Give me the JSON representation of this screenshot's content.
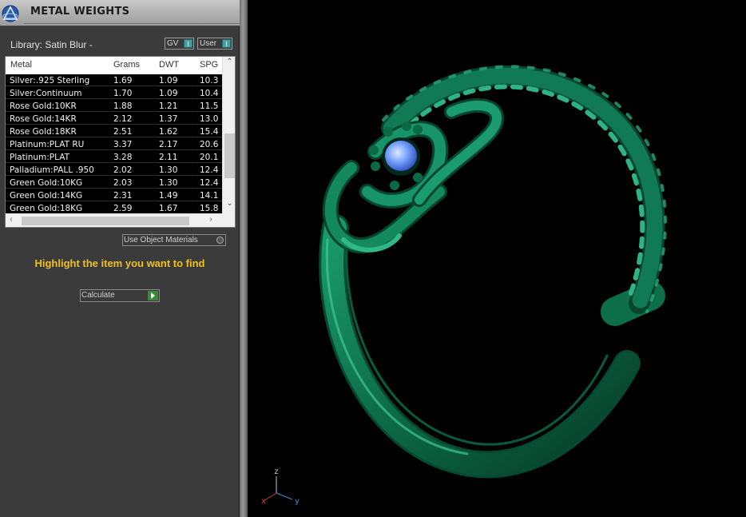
{
  "panel": {
    "title": "METAL WEIGHTS",
    "library_label": "Library: Satin Blur -",
    "toggle_gv": "GV",
    "toggle_user": "User",
    "use_object_materials": "Use Object Materials",
    "highlight_hint": "Highlight the item you want to find",
    "calculate_label": "Calculate"
  },
  "table": {
    "headers": [
      "Metal",
      "Grams",
      "DWT",
      "SPG"
    ],
    "rows": [
      [
        "Silver:.925 Sterling",
        "1.69",
        "1.09",
        "10.3"
      ],
      [
        "Silver:Continuum",
        "1.70",
        "1.09",
        "10.4"
      ],
      [
        "Rose Gold:10KR",
        "1.88",
        "1.21",
        "11.5"
      ],
      [
        "Rose Gold:14KR",
        "2.12",
        "1.37",
        "13.0"
      ],
      [
        "Rose Gold:18KR",
        "2.51",
        "1.62",
        "15.4"
      ],
      [
        "Platinum:PLAT RU",
        "3.37",
        "2.17",
        "20.6"
      ],
      [
        "Platinum:PLAT",
        "3.28",
        "2.11",
        "20.1"
      ],
      [
        "Palladium:PALL .950",
        "2.02",
        "1.30",
        "12.4"
      ],
      [
        "Green Gold:10KG",
        "2.03",
        "1.30",
        "12.4"
      ],
      [
        "Green Gold:14KG",
        "2.31",
        "1.49",
        "14.1"
      ],
      [
        "Green Gold:18KG",
        "2.59",
        "1.67",
        "15.8"
      ]
    ]
  },
  "axes": {
    "x": "x",
    "y": "y",
    "z": "z"
  },
  "colors": {
    "ring": "#0f7a55",
    "ring_highlight": "#38b58a",
    "gem": "#7aa6ff",
    "highlight_text": "#f0c020"
  }
}
